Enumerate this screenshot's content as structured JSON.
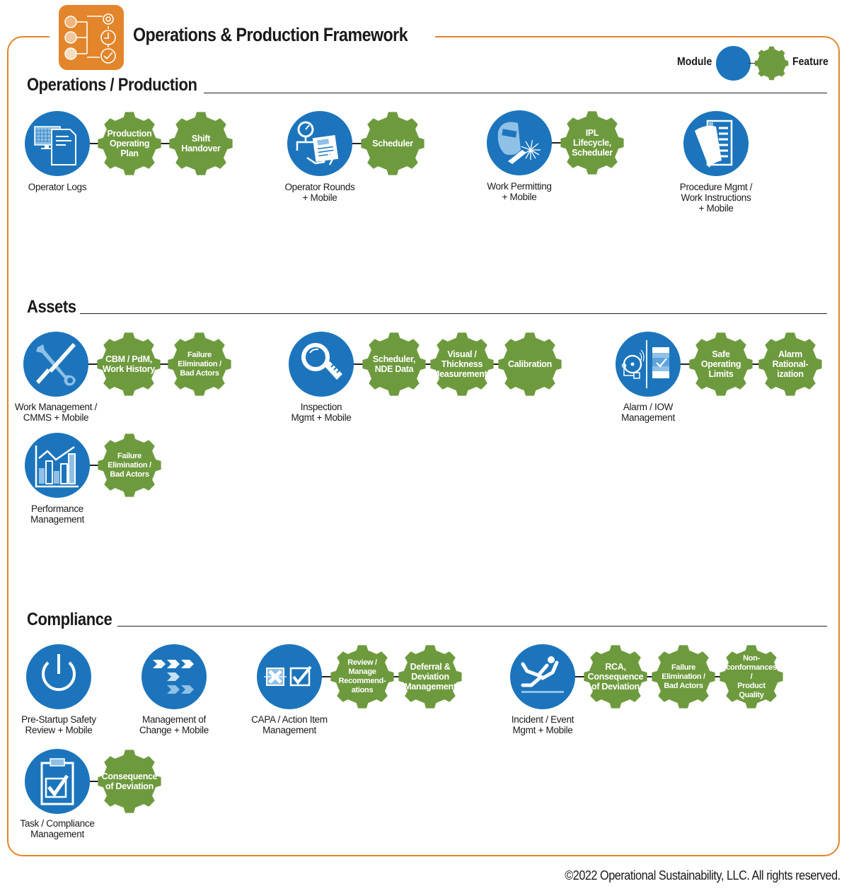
{
  "title": "Operations & Production Framework",
  "legend": {
    "module_label": "Module",
    "feature_label": "Feature"
  },
  "colors": {
    "frame": "#E3852A",
    "module": "#1C75BC",
    "feature": "#6E9A3E",
    "icon_light": "#8FC0E6"
  },
  "sections": [
    {
      "title": "Operations / Production",
      "modules": [
        {
          "label": "Operator Logs",
          "icon": "monitor-document-icon",
          "features": [
            "Production\nOperating\nPlan",
            "Shift\nHandover"
          ]
        },
        {
          "label": "Operator Rounds\n+ Mobile",
          "icon": "gauge-tablet-icon",
          "features": [
            "Scheduler"
          ]
        },
        {
          "label": "Work Permitting\n+ Mobile",
          "icon": "welding-mask-icon",
          "features": [
            "IPL\nLifecycle,\nScheduler"
          ]
        },
        {
          "label": "Procedure Mgmt /\nWork Instructions\n+ Mobile",
          "icon": "procedure-pages-icon",
          "features": []
        }
      ]
    },
    {
      "title": "Assets",
      "modules": [
        {
          "label": "Work Management /\nCMMS + Mobile",
          "icon": "wrench-screwdriver-icon",
          "features": [
            "CBM / PdM,\nWork History",
            "Failure\nElimination /\nBad Actors"
          ]
        },
        {
          "label": "Inspection\nMgmt + Mobile",
          "icon": "magnifier-icon",
          "features": [
            "Scheduler,\nNDE Data",
            "Visual /\nThickness\nMeasurements",
            "Calibration"
          ]
        },
        {
          "label": "Alarm / IOW\nManagement",
          "icon": "alarm-bell-checklist-icon",
          "features": [
            "Safe\nOperating\nLimits",
            "Alarm\nRational-\nization"
          ]
        },
        {
          "label": "Performance\nManagement",
          "icon": "bar-chart-icon",
          "features": [
            "Failure\nElimination /\nBad Actors"
          ]
        }
      ]
    },
    {
      "title": "Compliance",
      "modules": [
        {
          "label": "Pre-Startup Safety\nReview + Mobile",
          "icon": "power-icon",
          "features": []
        },
        {
          "label": "Management of\nChange + Mobile",
          "icon": "chevron-flow-icon",
          "features": []
        },
        {
          "label": "CAPA / Action Item\nManagement",
          "icon": "checkbox-x-check-icon",
          "features": [
            "Review /\nManage\nRecommend-\nations",
            "Deferral &\nDeviation\nManagement"
          ]
        },
        {
          "label": "Incident / Event\nMgmt + Mobile",
          "icon": "falling-person-icon",
          "features": [
            "RCA,\nConsequence\nof Deviation",
            "Failure\nElimination /\nBad Actors",
            "Non-\nconformances /\nProduct\nQuality"
          ]
        },
        {
          "label": "Task / Compliance\nManagement",
          "icon": "clipboard-check-icon",
          "features": [
            "Consequence\nof Deviation"
          ]
        }
      ]
    }
  ],
  "copyright": "©2022 Operational Sustainability, LLC. All rights reserved."
}
